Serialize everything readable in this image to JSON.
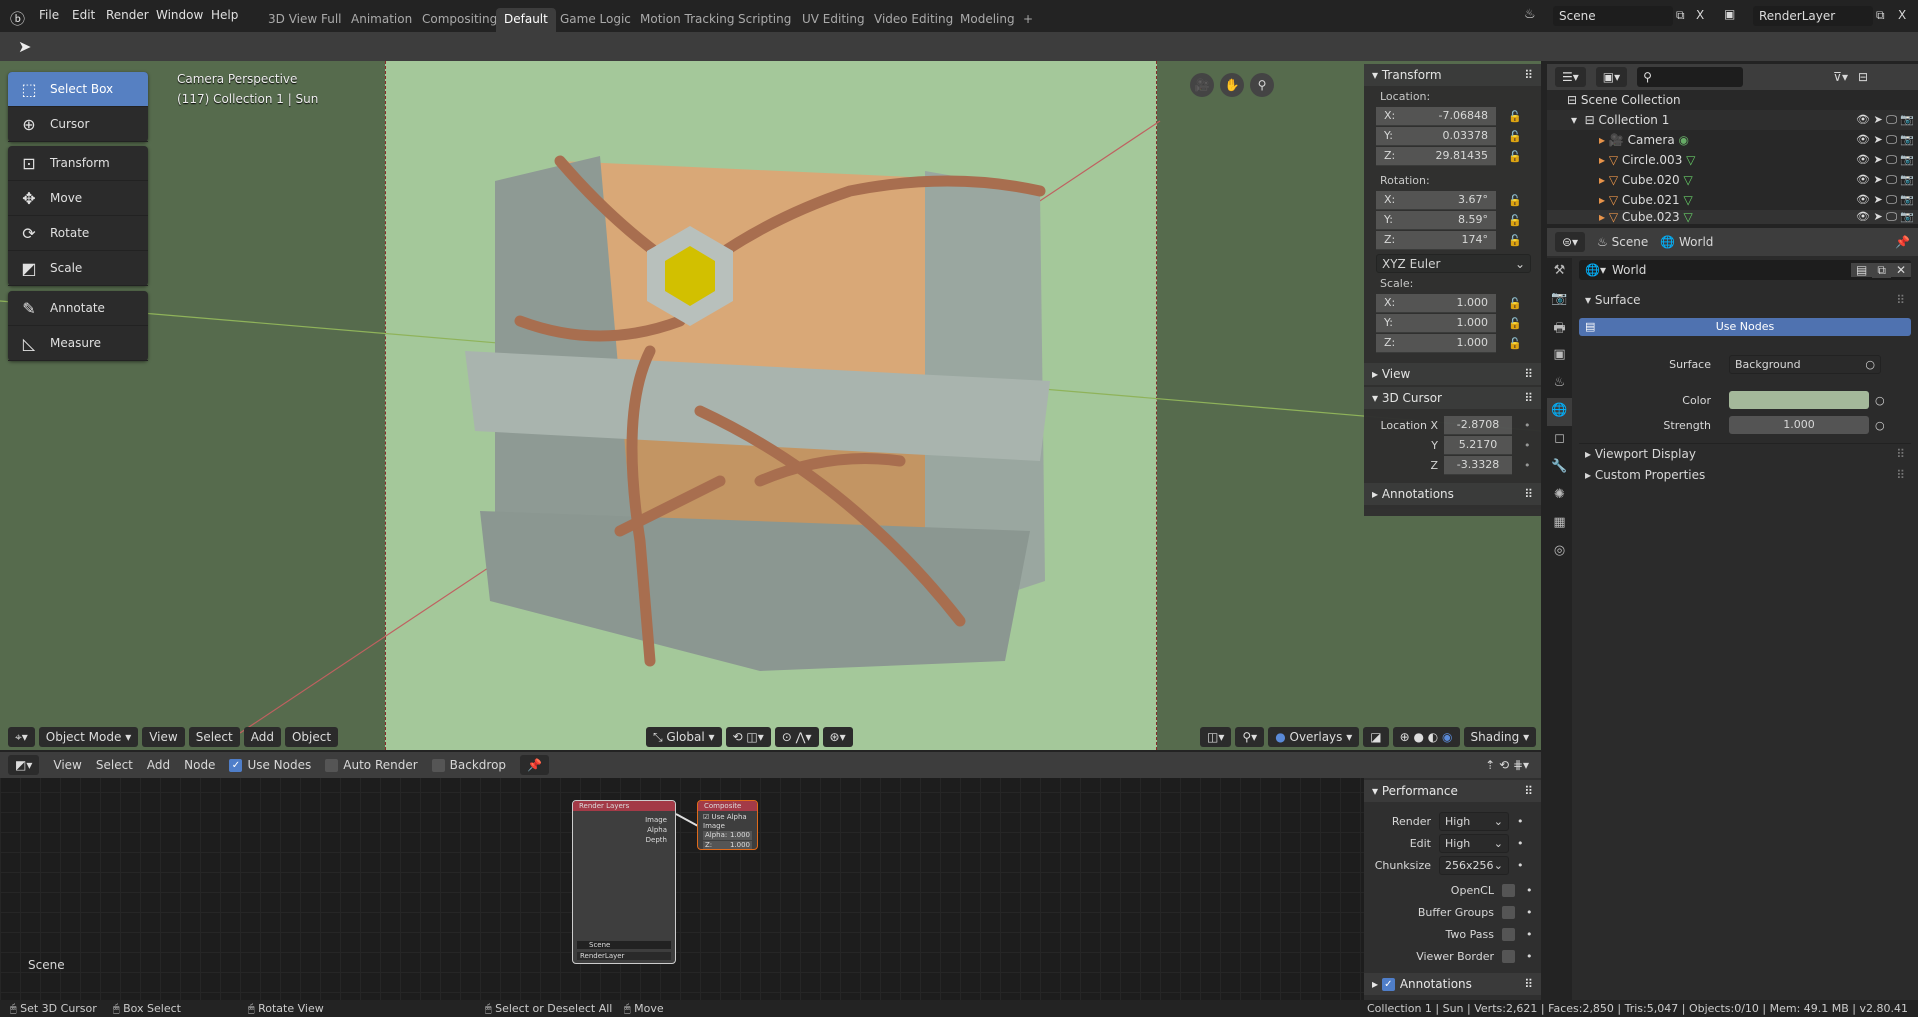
{
  "topbar": {
    "menu": [
      "File",
      "Edit",
      "Render",
      "Window",
      "Help"
    ],
    "workspaces": [
      "3D View Full",
      "Animation",
      "Compositing",
      "Default",
      "Game Logic",
      "Motion Tracking",
      "Scripting",
      "UV Editing",
      "Video Editing",
      "Modeling"
    ],
    "active_workspace": "Default",
    "add_label": "+",
    "scene": "Scene",
    "render_layer": "RenderLayer",
    "close_label": "X"
  },
  "toolbar": {
    "tools": [
      {
        "label": "Select Box",
        "icon": "select-box-icon",
        "glyph": "⬚",
        "active": true
      },
      {
        "label": "Cursor",
        "icon": "cursor-icon",
        "glyph": "⊕"
      },
      {
        "label": "Transform",
        "icon": "transform-icon",
        "glyph": "⊡"
      },
      {
        "label": "Move",
        "icon": "move-icon",
        "glyph": "✥"
      },
      {
        "label": "Rotate",
        "icon": "rotate-icon",
        "glyph": "⟳"
      },
      {
        "label": "Scale",
        "icon": "scale-icon",
        "glyph": "◩"
      },
      {
        "label": "Annotate",
        "icon": "annotate-icon",
        "glyph": "✎"
      },
      {
        "label": "Measure",
        "icon": "measure-icon",
        "glyph": "◺"
      }
    ]
  },
  "viewport": {
    "view_name": "Camera Perspective",
    "info": "(117) Collection 1 | Sun",
    "header": {
      "mode": "Object Mode",
      "menus": [
        "View",
        "Select",
        "Add",
        "Object"
      ],
      "orientation": "Global",
      "overlays": "Overlays",
      "shading": "Shading"
    },
    "world_color": "#a4c89a"
  },
  "npanel": {
    "transform": "Transform",
    "location_label": "Location:",
    "location": [
      [
        "X:",
        "-7.06848"
      ],
      [
        "Y:",
        "0.03378"
      ],
      [
        "Z:",
        "29.81435"
      ]
    ],
    "rotation_label": "Rotation:",
    "rotation": [
      [
        "X:",
        "3.67°"
      ],
      [
        "Y:",
        "8.59°"
      ],
      [
        "Z:",
        "174°"
      ]
    ],
    "rotation_mode": "XYZ Euler",
    "scale_label": "Scale:",
    "scale": [
      [
        "X:",
        "1.000"
      ],
      [
        "Y:",
        "1.000"
      ],
      [
        "Z:",
        "1.000"
      ]
    ],
    "view": "View",
    "cursor": "3D Cursor",
    "cursor_location": [
      [
        "Location X",
        "-2.8708"
      ],
      [
        "Y",
        "5.2170"
      ],
      [
        "Z",
        "-3.3328"
      ]
    ],
    "annotations": "Annotations"
  },
  "outliner": {
    "root": "Scene Collection",
    "collection": "Collection 1",
    "items": [
      {
        "name": "Camera",
        "type": "camera"
      },
      {
        "name": "Circle.003",
        "type": "mesh"
      },
      {
        "name": "Cube.020",
        "type": "mesh"
      },
      {
        "name": "Cube.021",
        "type": "mesh"
      },
      {
        "name": "Cube.023",
        "type": "mesh"
      }
    ]
  },
  "properties": {
    "breadcrumb_scene": "Scene",
    "breadcrumb_world": "World",
    "world_name": "World",
    "surface_panel": "Surface",
    "use_nodes": "Use Nodes",
    "surface_label": "Surface",
    "surface_value": "Background",
    "color_label": "Color",
    "color_value": "#a4b89a",
    "strength_label": "Strength",
    "strength_value": "1.000",
    "viewport_display": "Viewport Display",
    "custom_properties": "Custom Properties"
  },
  "node_editor": {
    "menus": [
      "View",
      "Select",
      "Add",
      "Node"
    ],
    "use_nodes": "Use Nodes",
    "auto_render": "Auto Render",
    "backdrop": "Backdrop",
    "scene_label": "Scene",
    "render_layers": {
      "title": "Render Layers",
      "outputs": [
        "Image",
        "Alpha",
        "Depth"
      ],
      "scene": "Scene",
      "layer": "RenderLayer"
    },
    "composite": {
      "title": "Composite",
      "use_alpha": "Use Alpha",
      "image": "Image",
      "alpha_label": "Alpha:",
      "alpha": "1.000",
      "z_label": "Z:",
      "z": "1.000"
    },
    "performance": {
      "title": "Performance",
      "render_label": "Render",
      "render": "High",
      "edit_label": "Edit",
      "edit": "High",
      "chunk_label": "Chunksize",
      "chunk": "256x256",
      "opencl": "OpenCL",
      "buffer_groups": "Buffer Groups",
      "two_pass": "Two Pass",
      "viewer_border": "Viewer Border",
      "annotations": "Annotations"
    }
  },
  "statusbar": {
    "items": [
      "Set 3D Cursor",
      "Box Select",
      "Rotate View",
      "Select or Deselect All",
      "Move"
    ],
    "stats": "Collection 1 | Sun | Verts:2,621 | Faces:2,850 | Tris:5,047 | Objects:0/10 | Mem: 49.1 MB | v2.80.41"
  }
}
